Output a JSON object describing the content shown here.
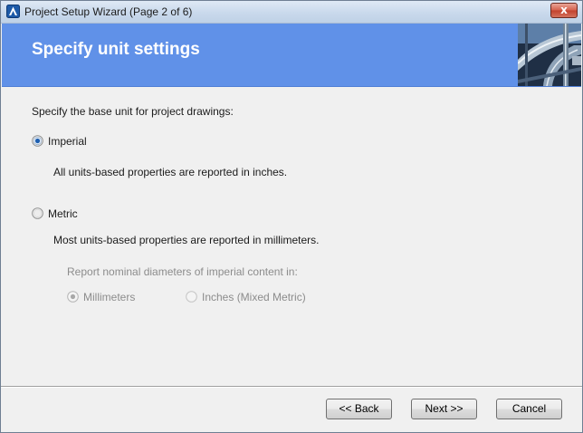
{
  "window": {
    "title": "Project Setup Wizard (Page 2 of 6)",
    "close_glyph": "x"
  },
  "header": {
    "title": "Specify unit settings"
  },
  "main": {
    "prompt": "Specify the base unit for project drawings:",
    "options": [
      {
        "label": "Imperial",
        "selected": true,
        "description": "All units-based properties are reported in inches."
      },
      {
        "label": "Metric",
        "selected": false,
        "description": "Most units-based properties are reported in millimeters."
      }
    ],
    "nominal": {
      "label": "Report nominal diameters of imperial content in:",
      "enabled": false,
      "options": [
        {
          "label": "Millimeters",
          "selected": true
        },
        {
          "label": "Inches (Mixed Metric)",
          "selected": false
        }
      ]
    }
  },
  "footer": {
    "back_label": "<< Back",
    "next_label": "Next >>",
    "cancel_label": "Cancel"
  },
  "colors": {
    "banner": "#6091e8",
    "close_button": "#c2402c",
    "disabled_text": "#8c8c8c"
  }
}
